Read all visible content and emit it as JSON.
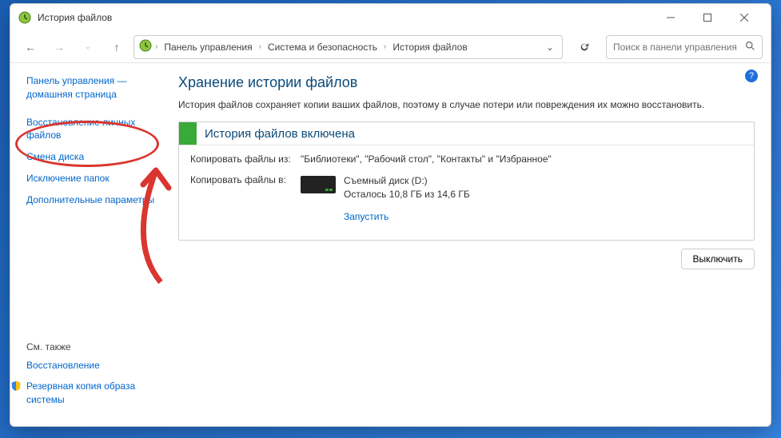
{
  "window": {
    "title": "История файлов"
  },
  "breadcrumb": {
    "items": [
      "Панель управления",
      "Система и безопасность",
      "История файлов"
    ]
  },
  "search": {
    "placeholder": "Поиск в панели управления"
  },
  "sidebar": {
    "home": "Панель управления — домашняя страница",
    "links": [
      "Восстановление личных файлов",
      "Смена диска",
      "Исключение папок",
      "Дополнительные параметры"
    ],
    "see_also_label": "См. также",
    "see_also_links": [
      "Восстановление",
      "Резервная копия образа системы"
    ]
  },
  "main": {
    "heading": "Хранение истории файлов",
    "description": "История файлов сохраняет копии ваших файлов, поэтому в случае потери или повреждения их можно восстановить.",
    "status_title": "История файлов включена",
    "copy_from_label": "Копировать файлы из:",
    "copy_from_value": "\"Библиотеки\", \"Рабочий стол\", \"Контакты\" и \"Избранное\"",
    "copy_to_label": "Копировать файлы в:",
    "drive_name": "Съемный диск (D:)",
    "drive_space": "Осталось 10,8 ГБ из 14,6 ГБ",
    "run_link": "Запустить",
    "off_button": "Выключить"
  }
}
